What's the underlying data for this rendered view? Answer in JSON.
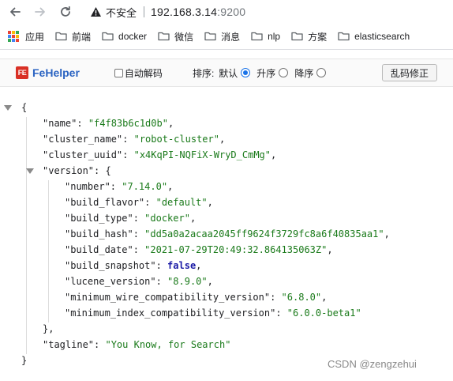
{
  "browser": {
    "security_label": "不安全",
    "url_host": "192.168.3.14",
    "url_port": ":9200",
    "icons": {
      "back": "arrow-left-icon",
      "forward": "arrow-right-icon",
      "reload": "reload-icon",
      "security": "warning-triangle-icon"
    }
  },
  "bookmarks": {
    "items": [
      {
        "label": "应用",
        "icon": "apps-grid-icon"
      },
      {
        "label": "前端",
        "icon": "folder-icon"
      },
      {
        "label": "docker",
        "icon": "folder-icon"
      },
      {
        "label": "微信",
        "icon": "folder-icon"
      },
      {
        "label": "消息",
        "icon": "folder-icon"
      },
      {
        "label": "nlp",
        "icon": "folder-icon"
      },
      {
        "label": "方案",
        "icon": "folder-icon"
      },
      {
        "label": "elasticsearch",
        "icon": "folder-icon"
      }
    ],
    "apps_colors": [
      "#ea4335",
      "#fbbc05",
      "#34a853",
      "#4285f4",
      "#ea4335",
      "#fbbc05",
      "#34a853",
      "#4285f4",
      "#ea4335"
    ]
  },
  "fehelper": {
    "logo_badge": "FE",
    "logo_name": "FeHelper",
    "auto_decode_label": "自动解码",
    "auto_decode_checked": false,
    "sort_label": "排序:",
    "sort_options": [
      {
        "label": "默认",
        "selected": true
      },
      {
        "label": "升序",
        "selected": false
      },
      {
        "label": "降序",
        "selected": false
      }
    ],
    "fix_button": "乱码修正",
    "accent": "#2a63c2",
    "badge_color": "#d93025"
  },
  "json": {
    "open_brace": "{",
    "close_brace": "}",
    "name_key": "\"name\"",
    "name_val": "\"f4f83b6c1d0b\"",
    "cluster_name_key": "\"cluster_name\"",
    "cluster_name_val": "\"robot-cluster\"",
    "cluster_uuid_key": "\"cluster_uuid\"",
    "cluster_uuid_val": "\"x4KqPI-NQFiX-WryD_CmMg\"",
    "version_key": "\"version\"",
    "version_open": "{",
    "version_close": "},",
    "number_key": "\"number\"",
    "number_val": "\"7.14.0\"",
    "build_flavor_key": "\"build_flavor\"",
    "build_flavor_val": "\"default\"",
    "build_type_key": "\"build_type\"",
    "build_type_val": "\"docker\"",
    "build_hash_key": "\"build_hash\"",
    "build_hash_val": "\"dd5a0a2acaa2045ff9624f3729fc8a6f40835aa1\"",
    "build_date_key": "\"build_date\"",
    "build_date_val": "\"2021-07-29T20:49:32.864135063Z\"",
    "build_snapshot_key": "\"build_snapshot\"",
    "build_snapshot_val": "false",
    "lucene_version_key": "\"lucene_version\"",
    "lucene_version_val": "\"8.9.0\"",
    "min_wire_key": "\"minimum_wire_compatibility_version\"",
    "min_wire_val": "\"6.8.0\"",
    "min_index_key": "\"minimum_index_compatibility_version\"",
    "min_index_val": "\"6.0.0-beta1\"",
    "tagline_key": "\"tagline\"",
    "tagline_val": "\"You Know, for Search\"",
    "colors": {
      "string": "#1a7a1a",
      "boolean": "#1a1aa6",
      "key": "#202124"
    }
  },
  "watermark": "CSDN @zengzehui"
}
